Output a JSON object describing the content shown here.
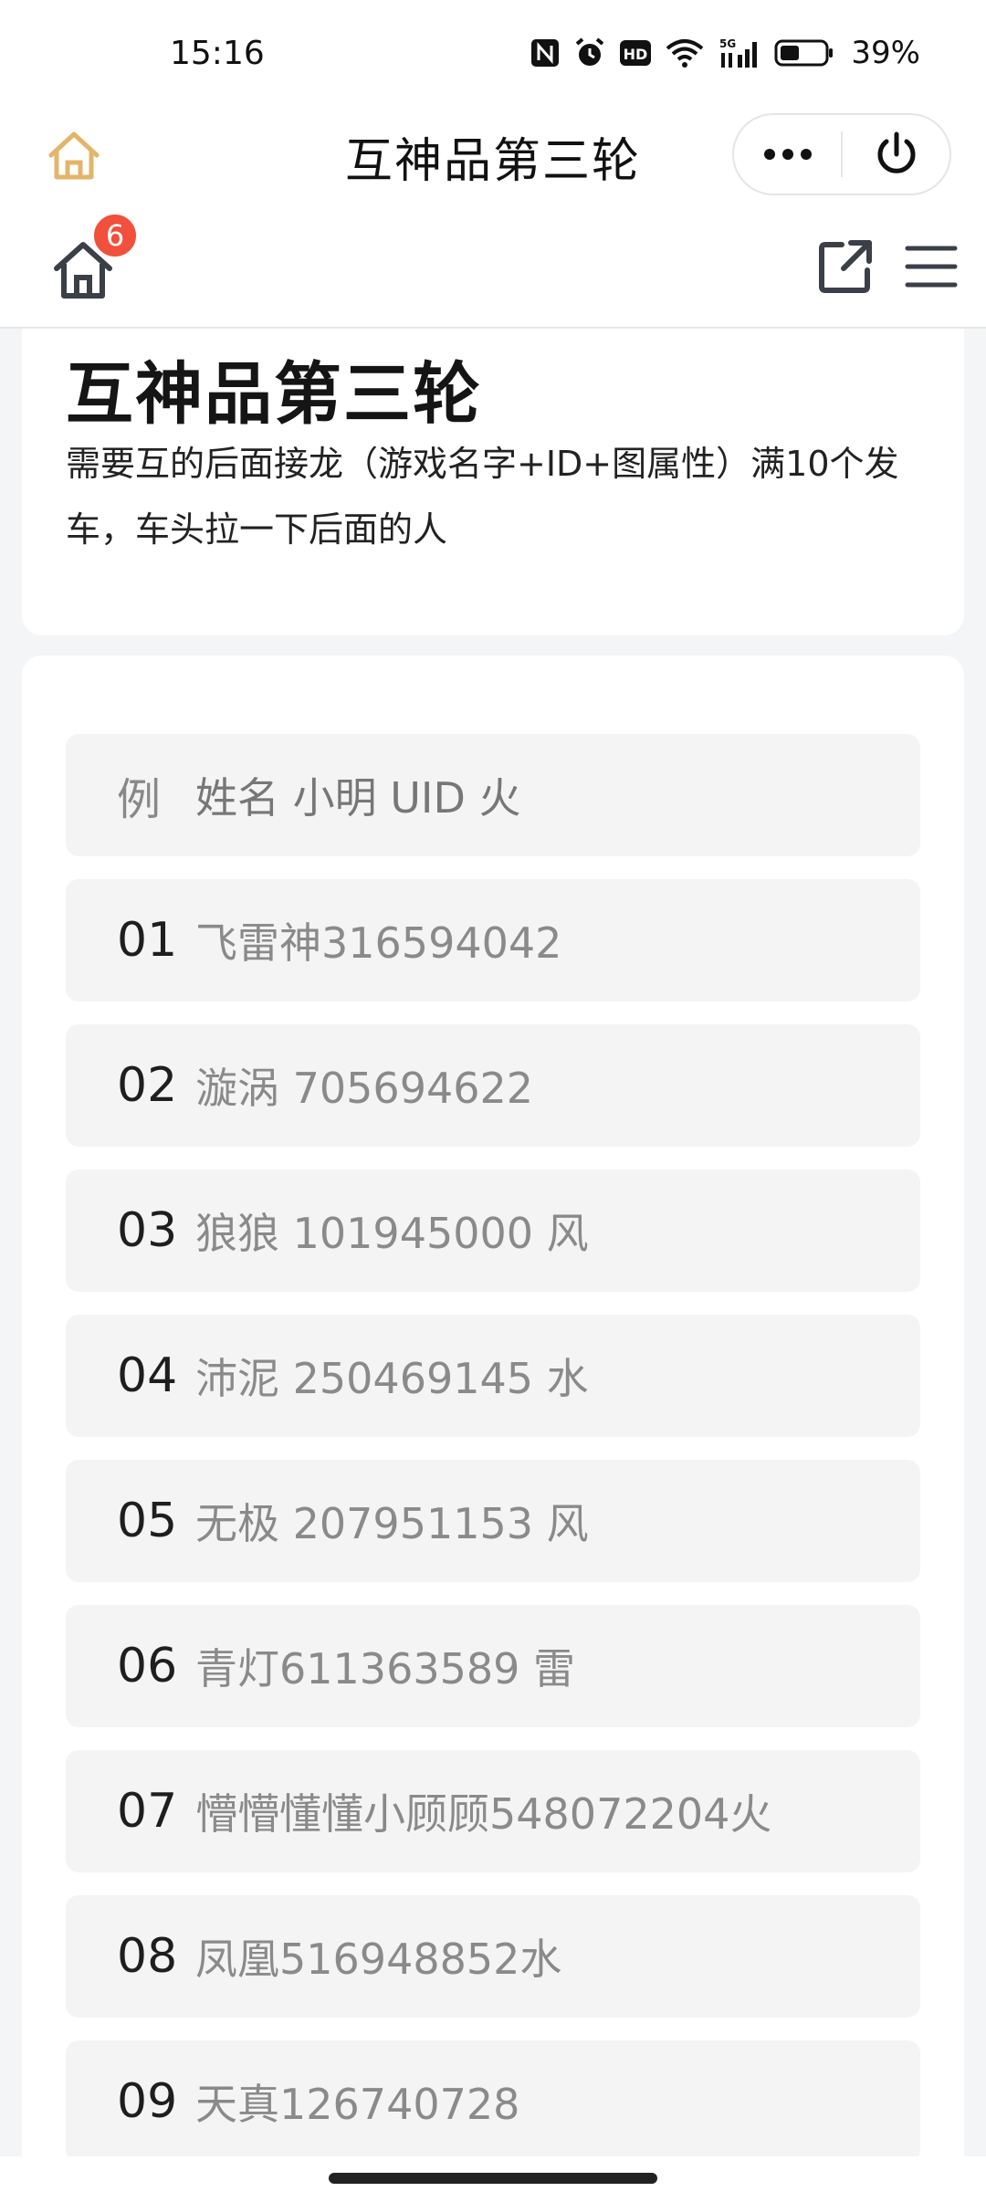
{
  "status_bar": {
    "time": "15:16",
    "battery": "39%",
    "signal": "5G",
    "icons": [
      "nfc-icon",
      "alarm-icon",
      "hd-icon",
      "wifi-icon",
      "signal-icon",
      "battery-icon"
    ]
  },
  "header": {
    "title": "互神品第三轮",
    "home_icon": "home-outline-icon",
    "more_icon": "more-dots-icon",
    "close_icon": "power-icon"
  },
  "toolbar": {
    "badge_count": "6",
    "home_icon": "home-icon",
    "share_icon": "share-icon",
    "menu_icon": "menu-icon"
  },
  "info": {
    "title": "互神品第三轮",
    "description": "需要互的后面接龙（游戏名字+ID+图属性）满10个发车，车头拉一下后面的人"
  },
  "list": {
    "example": {
      "label": "例",
      "text": "姓名   小明 UID  火"
    },
    "rows": [
      {
        "num": "01",
        "text": "飞雷神316594042"
      },
      {
        "num": "02",
        "text": "漩涡  705694622"
      },
      {
        "num": "03",
        "text": "狼狼 101945000  风"
      },
      {
        "num": "04",
        "text": "沛泥 250469145 水"
      },
      {
        "num": "05",
        "text": "无极 207951153 风"
      },
      {
        "num": "06",
        "text": "青灯611363589 雷"
      },
      {
        "num": "07",
        "text": "懵懵懂懂小顾顾548072204火"
      },
      {
        "num": "08",
        "text": "凤凰516948852水"
      },
      {
        "num": "09",
        "text": "天真126740728"
      }
    ]
  },
  "colors": {
    "accent_home": "#e3b56a",
    "badge": "#f0503c",
    "row_bg": "#f4f4f5",
    "page_bg": "#f4f5f7"
  }
}
